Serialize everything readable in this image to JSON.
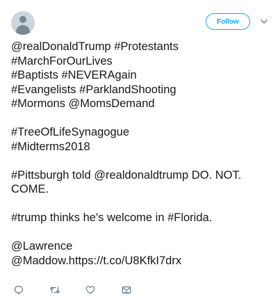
{
  "tweet": {
    "follow_label": "Follow",
    "text": "@realDonaldTrump #Protestants\n#MarchForOurLives\n#Baptists #NEVERAgain\n#Evangelists #ParklandShooting\n#Mormons @MomsDemand\n\n#TreeOfLifeSynagogue\n#Midterms2018\n\n#Pittsburgh told @realdonaldtrump DO. NOT.\nCOME.\n\n#trump thinks he's welcome in #Florida.\n\n@Lawrence\n@Maddow.https://t.co/U8KfkI7drx"
  },
  "icons": {
    "avatar": "default-avatar-icon",
    "caret": "chevron-down-icon",
    "reply": "reply-icon",
    "retweet": "retweet-icon",
    "like": "heart-icon",
    "message": "direct-message-icon"
  },
  "colors": {
    "accent": "#1da1f2",
    "text": "#14171a",
    "muted": "#657786",
    "avatar_bg": "#ccd6dd"
  }
}
